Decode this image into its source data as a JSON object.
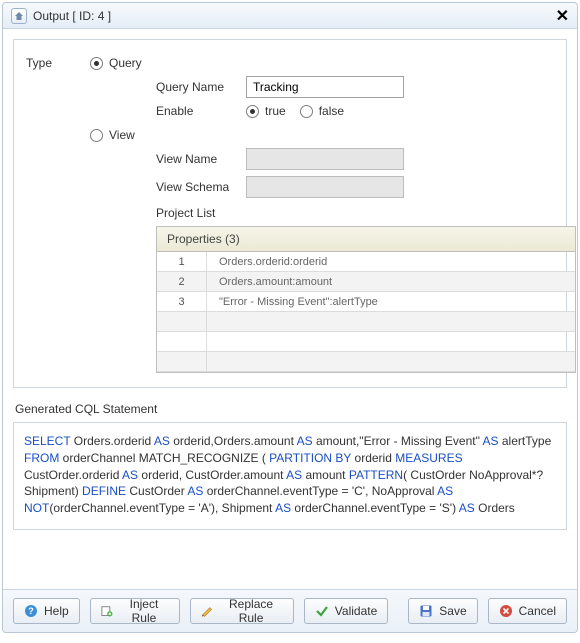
{
  "title": "Output [ ID: 4 ]",
  "form": {
    "typeLabel": "Type",
    "queryRadio": "Query",
    "viewRadio": "View",
    "selectedType": "Query",
    "queryNameLabel": "Query Name",
    "queryNameValue": "Tracking",
    "enableLabel": "Enable",
    "enableTrue": "true",
    "enableFalse": "false",
    "enableSelected": "true",
    "viewNameLabel": "View Name",
    "viewNameValue": "",
    "viewSchemaLabel": "View Schema",
    "viewSchemaValue": "",
    "projectListLabel": "Project List"
  },
  "properties": {
    "header": "Properties (3)",
    "rows": [
      "Orders.orderid:orderid",
      "Orders.amount:amount",
      "\"Error - Missing Event\":alertType"
    ]
  },
  "cql": {
    "label": "Generated CQL Statement",
    "tokens": [
      {
        "t": "SELECT",
        "k": true
      },
      {
        "t": " Orders.orderid "
      },
      {
        "t": "AS",
        "k": true
      },
      {
        "t": " orderid,Orders.amount "
      },
      {
        "t": "AS",
        "k": true
      },
      {
        "t": " amount,\"Error - Missing Event\" "
      },
      {
        "t": "AS",
        "k": true
      },
      {
        "t": " alertType "
      },
      {
        "t": "FROM",
        "k": true
      },
      {
        "t": " orderChannel  MATCH_RECOGNIZE ( "
      },
      {
        "t": "PARTITION BY",
        "k": true
      },
      {
        "t": " orderid "
      },
      {
        "t": "MEASURES",
        "k": true
      },
      {
        "t": " CustOrder.orderid "
      },
      {
        "t": "AS",
        "k": true
      },
      {
        "t": " orderid, CustOrder.amount "
      },
      {
        "t": "AS",
        "k": true
      },
      {
        "t": " amount "
      },
      {
        "t": "PATTERN",
        "k": true
      },
      {
        "t": "( CustOrder NoApproval*? Shipment) "
      },
      {
        "t": "DEFINE",
        "k": true
      },
      {
        "t": " CustOrder "
      },
      {
        "t": "AS",
        "k": true
      },
      {
        "t": " orderChannel.eventType = 'C', NoApproval "
      },
      {
        "t": "AS",
        "k": true
      },
      {
        "t": " "
      },
      {
        "t": "NOT",
        "k": true
      },
      {
        "t": "(orderChannel.eventType = 'A'), Shipment "
      },
      {
        "t": "AS",
        "k": true
      },
      {
        "t": " orderChannel.eventType = 'S') "
      },
      {
        "t": "AS",
        "k": true
      },
      {
        "t": " Orders"
      }
    ]
  },
  "buttons": {
    "help": "Help",
    "inject": "Inject Rule",
    "replace": "Replace Rule",
    "validate": "Validate",
    "save": "Save",
    "cancel": "Cancel"
  }
}
